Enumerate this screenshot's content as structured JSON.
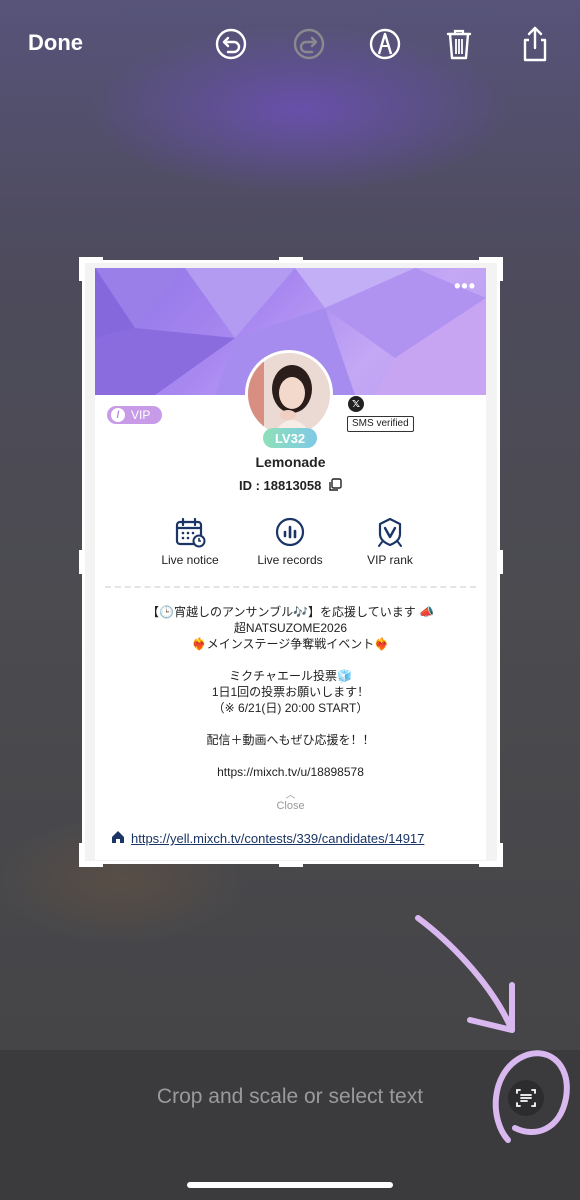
{
  "topbar": {
    "done_label": "Done",
    "icons": [
      "undo-icon",
      "redo-icon",
      "markup-pen-icon",
      "trash-icon",
      "share-icon"
    ]
  },
  "card": {
    "vip_label": "VIP",
    "vip_icon_text": "/",
    "level_label": "LV32",
    "x_badge": "𝕏",
    "sms_label": "SMS verified",
    "username": "Lemonade",
    "user_id": "ID : 18813058",
    "actions": [
      {
        "label": "Live notice",
        "icon": "calendar-clock-icon"
      },
      {
        "label": "Live records",
        "icon": "bar-chart-icon"
      },
      {
        "label": "VIP rank",
        "icon": "vip-rank-badge-icon"
      }
    ],
    "bio_lines": [
      "【🕒宵越しのアンサンブル🎶】を応援しています 📣",
      "超NATSUZOME2026",
      "❤️‍🔥メインステージ争奪戦イベント❤️‍🔥",
      "",
      "ミクチャエール投票🧊",
      "1日1回の投票お願いします！",
      "（※ 6/21(日) 20:00 START）",
      "",
      "配信＋動画へもぜひ応援を！！",
      "",
      "https://mixch.tv/u/18898578"
    ],
    "close_label": "Close",
    "home_link": "https://yell.mixch.tv/contests/339/candidates/14917"
  },
  "bottom": {
    "hint": "Crop and scale or select text"
  },
  "colors": {
    "accent_banner": "#a888f0",
    "vip_badge": "#c89be8",
    "annotation": "#d9b8f0"
  }
}
